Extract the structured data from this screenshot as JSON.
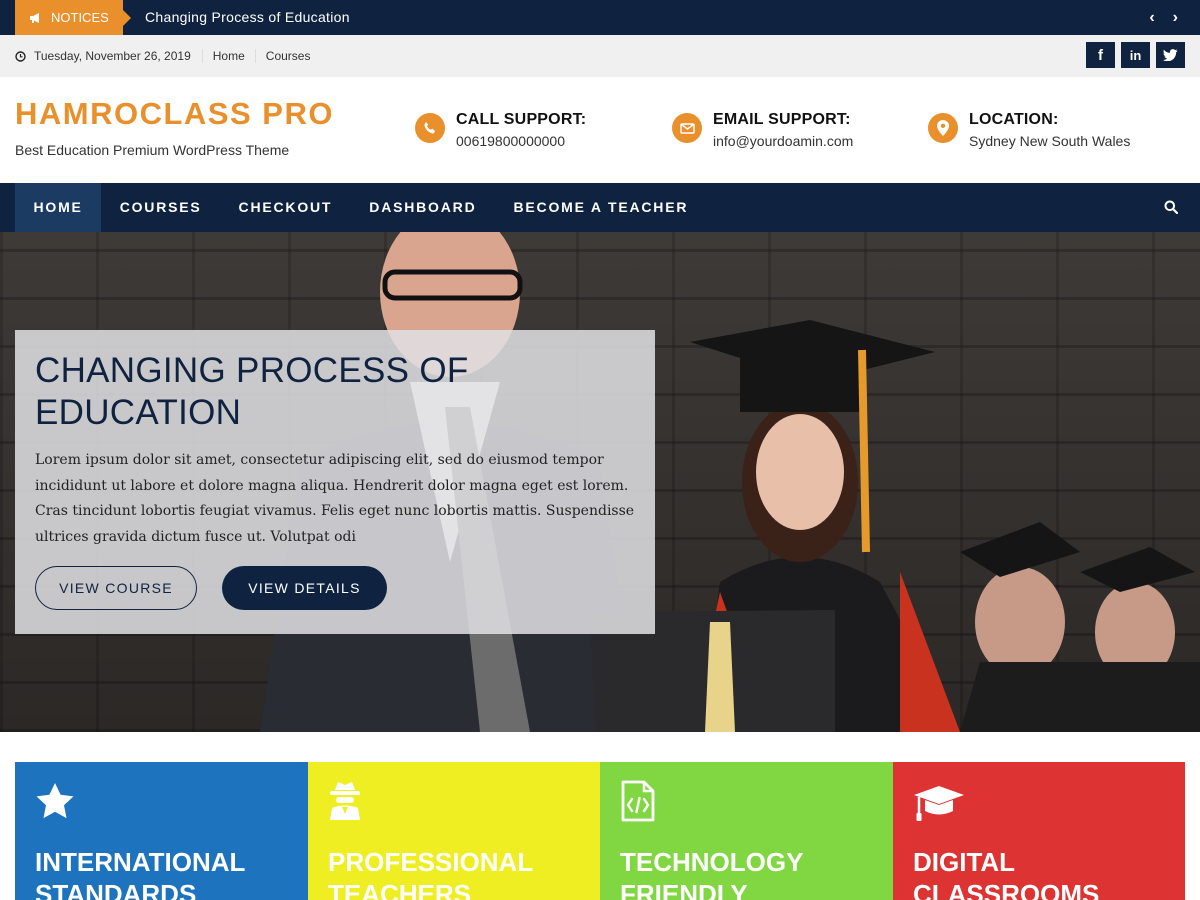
{
  "notice_bar": {
    "label": "NOTICES",
    "text": "Changing Process of Education",
    "prev_icon": "chevron-left-icon",
    "next_icon": "chevron-right-icon"
  },
  "info_bar": {
    "date": "Tuesday, November 26, 2019",
    "links": [
      "Home",
      "Courses"
    ],
    "social": [
      "facebook-icon",
      "linkedin-icon",
      "twitter-icon"
    ]
  },
  "header": {
    "site_title": "HAMROCLASS PRO",
    "tagline": "Best Education Premium WordPress Theme",
    "contacts": [
      {
        "icon": "phone-icon",
        "label": "CALL SUPPORT:",
        "value": "00619800000000"
      },
      {
        "icon": "envelope-icon",
        "label": "EMAIL SUPPORT:",
        "value": "info@yourdoamin.com"
      },
      {
        "icon": "map-pin-icon",
        "label": "LOCATION:",
        "value": "Sydney New South Wales"
      }
    ]
  },
  "nav": {
    "items": [
      "HOME",
      "COURSES",
      "CHECKOUT",
      "DASHBOARD",
      "BECOME A TEACHER"
    ],
    "active": "HOME",
    "search_icon": "search-icon"
  },
  "hero": {
    "title": "CHANGING PROCESS OF EDUCATION",
    "description": "Lorem ipsum dolor sit amet, consectetur adipiscing elit, sed do eiusmod tempor incididunt ut labore et dolore magna aliqua. Hendrerit dolor magna eget est lorem. Cras tincidunt lobortis feugiat vivamus. Felis eget nunc lobortis mattis. Suspendisse ultrices gravida dictum fusce ut. Volutpat odi",
    "buttons": [
      "VIEW COURSE",
      "VIEW DETAILS"
    ]
  },
  "features": [
    {
      "icon": "star-icon",
      "title": "INTERNATIONAL STANDARDS",
      "color": "#1e73be"
    },
    {
      "icon": "spy-icon",
      "title": "PROFESSIONAL TEACHERS",
      "color": "#eeee22"
    },
    {
      "icon": "code-file-icon",
      "title": "TECHNOLOGY FRIENDLY",
      "color": "#81d742"
    },
    {
      "icon": "graduation-cap-icon",
      "title": "DIGITAL CLASSROOMS",
      "color": "#dd3333"
    }
  ],
  "colors": {
    "navy": "#0f2340",
    "accent": "#e98f2c"
  }
}
